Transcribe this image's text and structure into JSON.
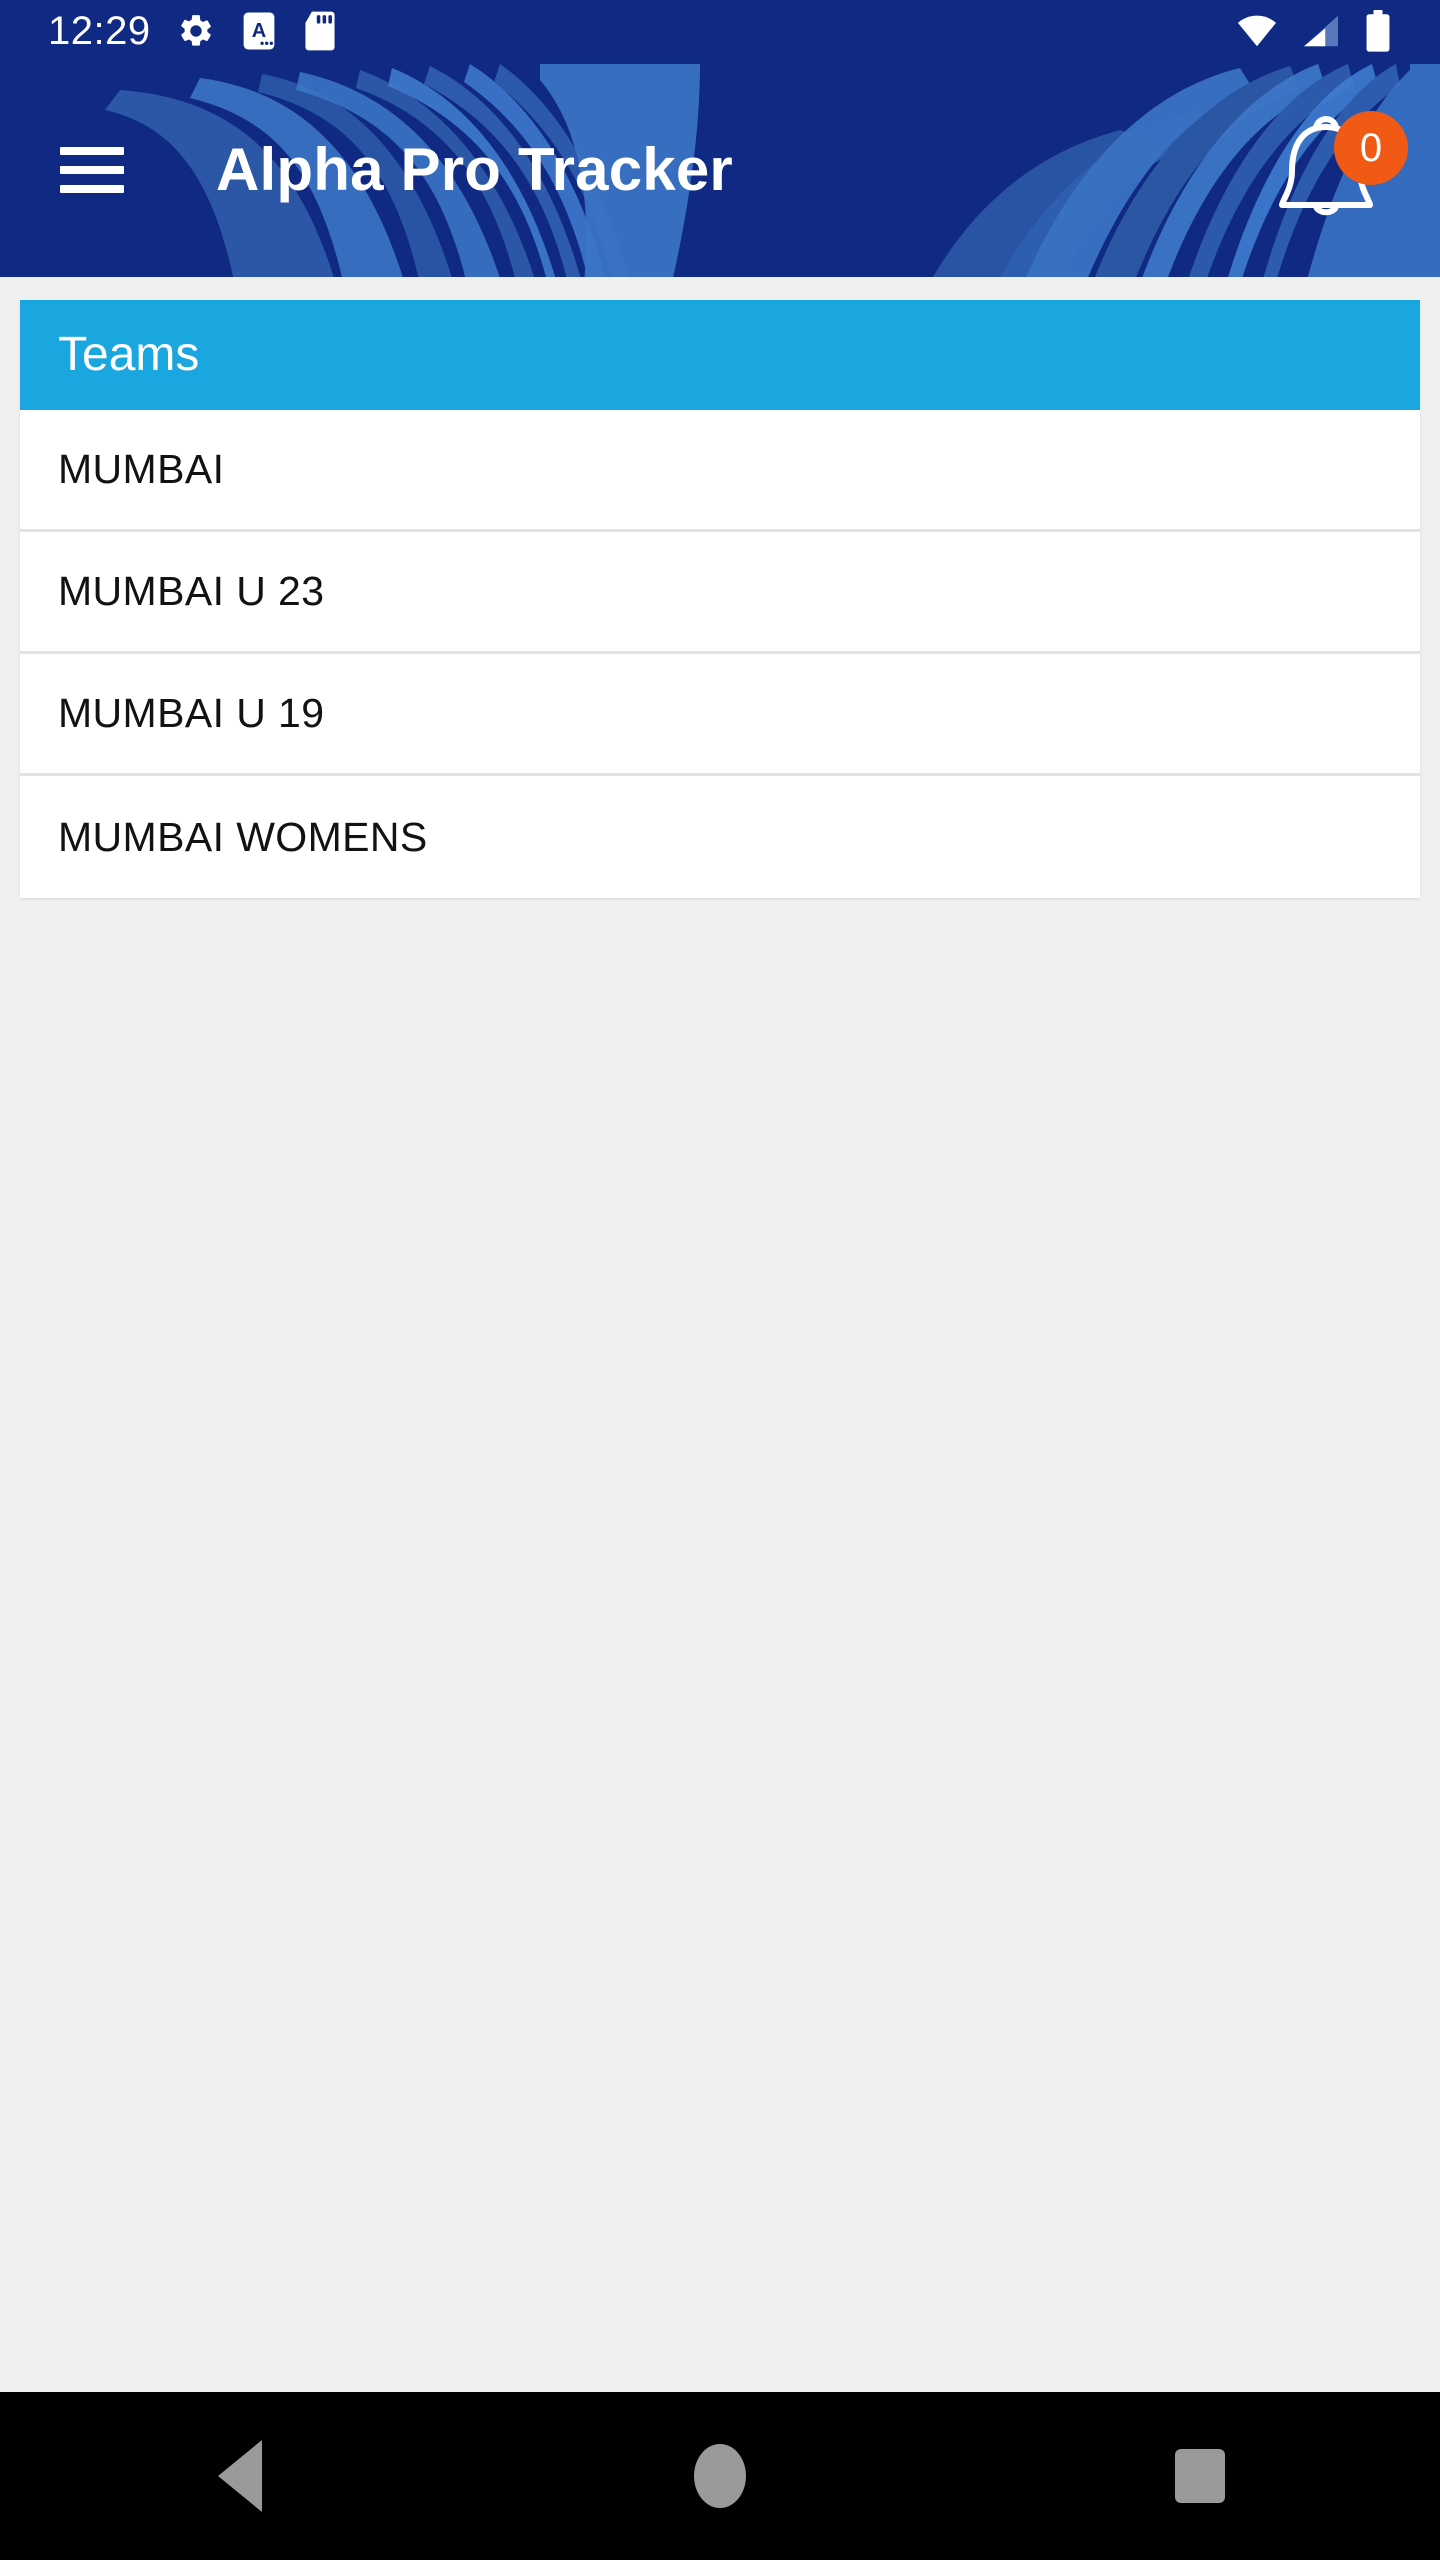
{
  "status_bar": {
    "clock": "12:29",
    "left_icons": [
      "gear-icon",
      "keyboard-a-icon",
      "sd-card-icon"
    ],
    "right_icons": [
      "wifi-icon",
      "cellular-signal-icon",
      "battery-icon"
    ],
    "background_color": "#102a83"
  },
  "app_bar": {
    "menu_icon": "hamburger-menu-icon",
    "title": "Alpha Pro Tracker",
    "notification_icon": "bell-icon",
    "notification_count": "0",
    "background_color": "#102a83",
    "badge_color": "#f05a14"
  },
  "card": {
    "header": {
      "title": "Teams",
      "background_color": "#1aa6de"
    },
    "rows": [
      {
        "label": "MUMBAI"
      },
      {
        "label": "MUMBAI U 23"
      },
      {
        "label": "MUMBAI U 19"
      },
      {
        "label": "MUMBAI WOMENS"
      }
    ]
  },
  "navigation_bar": {
    "back_label": "back-button",
    "home_label": "home-button",
    "recents_label": "recents-button",
    "background_color": "#000000",
    "icon_color": "#9a9a9a"
  }
}
